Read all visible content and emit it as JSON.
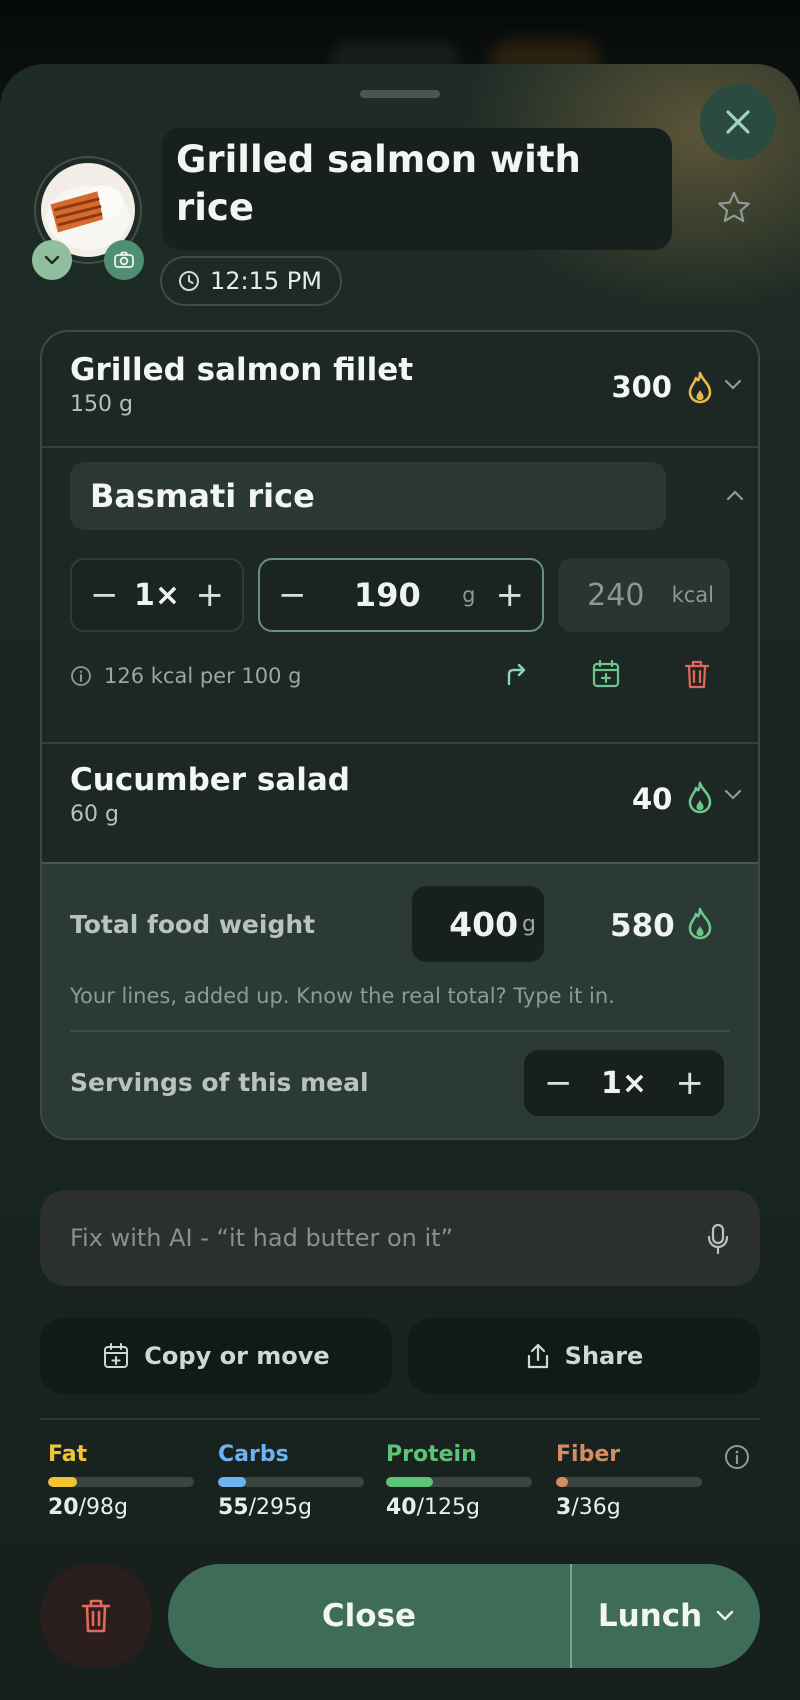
{
  "meal": {
    "title": "Grilled salmon with rice",
    "time": "12:15 PM"
  },
  "items": [
    {
      "name": "Grilled salmon fillet",
      "weight": "150 g",
      "kcal": "300",
      "flame_color": "#e8b84a"
    },
    {
      "name": "Basmati rice",
      "expanded": true,
      "multiplier": "1×",
      "amount": "190",
      "amount_unit": "g",
      "kcal_value": "240",
      "kcal_unit": "kcal",
      "info": "126 kcal per 100 g"
    },
    {
      "name": "Cucumber salad",
      "weight": "60 g",
      "kcal": "40",
      "flame_color": "#6cc58a"
    }
  ],
  "totals": {
    "weight_label": "Total food weight",
    "weight_value": "400",
    "weight_unit": "g",
    "kcal": "580",
    "hint": "Your lines, added up. Know the real total? Type it in.",
    "servings_label": "Servings of this meal",
    "servings_value": "1×"
  },
  "ai": {
    "placeholder": "Fix with AI - “it had butter on it”"
  },
  "actions": {
    "copy_move": "Copy or move",
    "share": "Share"
  },
  "macros": [
    {
      "name": "Fat",
      "value": "20",
      "goal": "/98g",
      "fraction": 0.2,
      "color": "#f2c432"
    },
    {
      "name": "Carbs",
      "value": "55",
      "goal": "/295g",
      "fraction": 0.19,
      "color": "#6cb4f0"
    },
    {
      "name": "Protein",
      "value": "40",
      "goal": "/125g",
      "fraction": 0.32,
      "color": "#5cc477"
    },
    {
      "name": "Fiber",
      "value": "3",
      "goal": "/36g",
      "fraction": 0.08,
      "color": "#d58d62"
    }
  ],
  "footer": {
    "close": "Close",
    "meal_type": "Lunch"
  }
}
